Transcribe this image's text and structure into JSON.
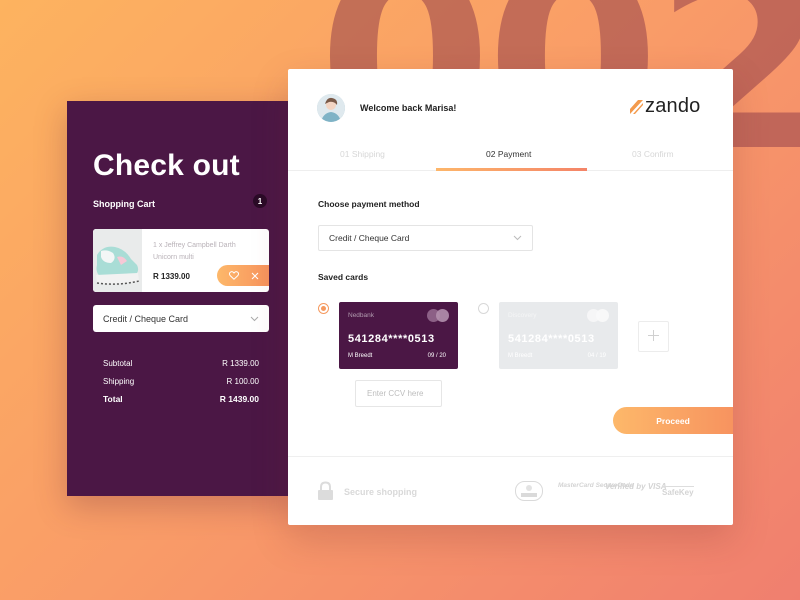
{
  "background": {
    "number": "002"
  },
  "checkout": {
    "title": "Check out",
    "cart_label": "Shopping Cart",
    "cart_count": "1",
    "item": {
      "name": "1 x Jeffrey Campbell Darth Unicorn multi",
      "price": "R 1339.00"
    },
    "payment_select": "Credit / Cheque Card",
    "summary": [
      {
        "label": "Subtotal",
        "value": "R 1339.00"
      },
      {
        "label": "Shipping",
        "value": "R 100.00"
      },
      {
        "label": "Total",
        "value": "R 1439.00"
      }
    ]
  },
  "header": {
    "welcome": "Welcome back Marisa!",
    "logo": "zando"
  },
  "steps": [
    "01 Shipping",
    "02 Payment",
    "03 Confirm"
  ],
  "payment": {
    "method_label": "Choose payment method",
    "method_value": "Credit / Cheque Card",
    "saved_label": "Saved cards",
    "cards": [
      {
        "bank": "Nedbank",
        "number": "541284****0513",
        "holder": "M Breedt",
        "expiry": "09 / 20",
        "selected": true
      },
      {
        "bank": "Discovery",
        "number": "541284****0513",
        "holder": "M Breedt",
        "expiry": "04 / 19",
        "selected": false
      }
    ],
    "ccv_placeholder": "Enter CCV here",
    "proceed": "Proceed"
  },
  "footer": {
    "secure": "Secure shopping",
    "badges": [
      "MasterCard SecureCode",
      "Verified by VISA",
      "SafeKey"
    ]
  },
  "colors": {
    "purple": "#4b1745",
    "orange": "#f7935f",
    "accent": "#fdb86a"
  },
  "icons": [
    "heart-icon",
    "close-icon",
    "chevron-down-icon",
    "plus-icon",
    "lock-icon",
    "mastercard-icon",
    "zando-logo-icon"
  ]
}
